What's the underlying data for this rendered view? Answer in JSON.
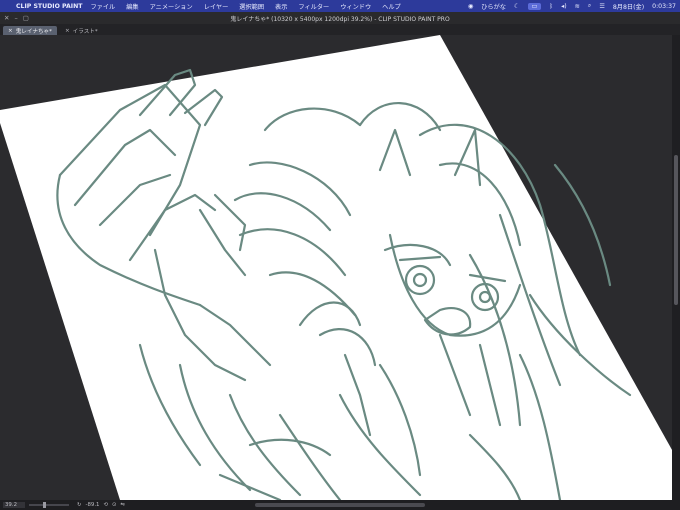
{
  "menubar": {
    "apple": "",
    "app_name": "CLIP STUDIO PAINT",
    "menus": [
      "ファイル",
      "編集",
      "アニメーション",
      "レイヤー",
      "選択範囲",
      "表示",
      "フィルター",
      "ウィンドウ",
      "ヘルプ"
    ],
    "status": {
      "input": "ひらがな",
      "date": "8月8日(金)",
      "time": "0:03:37"
    }
  },
  "window": {
    "title": "鬼レイナちゃ* (10320 x 5400px 1200dpi 39.2%) - CLIP STUDIO PAINT PRO"
  },
  "tabs": [
    {
      "label": "鬼レイナちゃ*",
      "active": true
    },
    {
      "label": "イラスト*",
      "active": false
    }
  ],
  "statusbar": {
    "zoom": "39.2",
    "rotation": "-89.1"
  },
  "colors": {
    "menubar_bg": "#2d3a9b",
    "canvas_bg": "#ffffff",
    "workspace_bg": "#2b2b2e",
    "stroke": "#6a8a82"
  },
  "icons": [
    "apple-icon",
    "close-icon",
    "minimize-icon",
    "maximize-icon",
    "moon-icon",
    "bluetooth-icon",
    "volume-icon",
    "wifi-icon",
    "search-icon",
    "control-center-icon"
  ]
}
